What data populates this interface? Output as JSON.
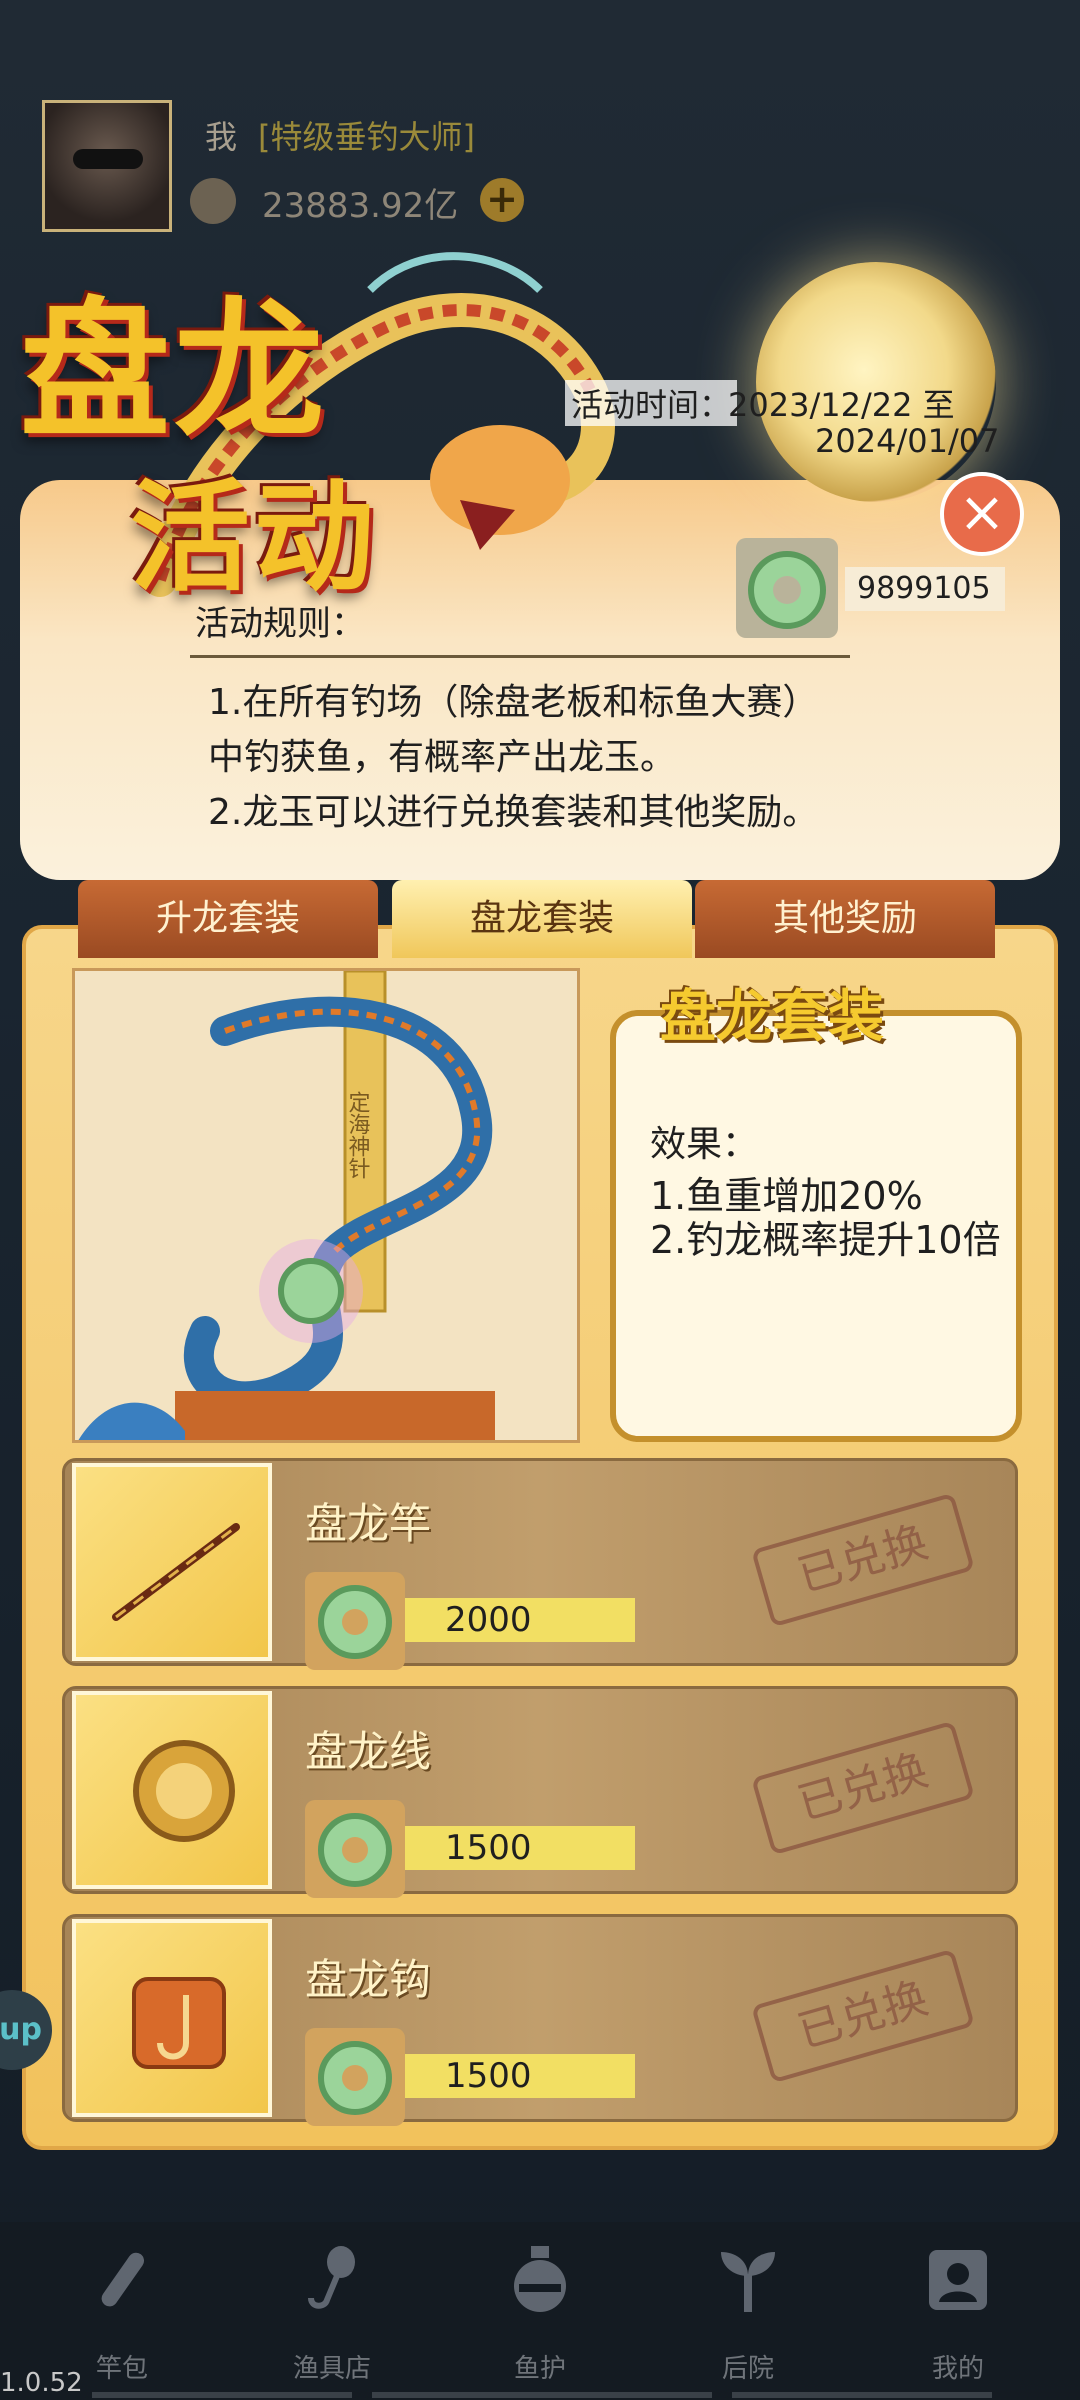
{
  "player": {
    "name": "我",
    "title": "[特级垂钓大师]",
    "coins": "23883.92亿",
    "add_icon": "+"
  },
  "event": {
    "title_line1": "盘龙",
    "title_line2": "活动",
    "time_label": "活动时间：",
    "time_start": "2023/12/22 至",
    "time_end": "2024/01/07",
    "close_icon": "close-icon",
    "jade_count": "9899105",
    "rules_title": "活动规则：",
    "rule_1a": "1.在所有钓场（除盘老板和标鱼大赛）",
    "rule_1b": "中钓获鱼，有概率产出龙玉。",
    "rule_2": "2.龙玉可以进行兑换套装和其他奖励。"
  },
  "tabs": [
    {
      "label": "升龙套装",
      "active": false
    },
    {
      "label": "盘龙套装",
      "active": true
    },
    {
      "label": "其他奖励",
      "active": false
    }
  ],
  "set": {
    "image_caption": "定海神针",
    "title": "盘龙套装",
    "effect_title": "效果：",
    "effect_1": "1.鱼重增加20%",
    "effect_2": "2.钓龙概率提升10倍"
  },
  "items": [
    {
      "name": "盘龙竿",
      "price": "2000",
      "status": "已兑换",
      "icon": "fishing-rod-icon"
    },
    {
      "name": "盘龙线",
      "price": "1500",
      "status": "已兑换",
      "icon": "fishing-line-icon"
    },
    {
      "name": "盘龙钩",
      "price": "1500",
      "status": "已兑换",
      "icon": "fishing-hook-icon"
    }
  ],
  "nav": [
    {
      "label": "竿包",
      "icon": "rod-bag-icon"
    },
    {
      "label": "渔具店",
      "icon": "tackle-shop-icon"
    },
    {
      "label": "鱼护",
      "icon": "fish-keeper-icon"
    },
    {
      "label": "后院",
      "icon": "backyard-icon"
    },
    {
      "label": "我的",
      "icon": "profile-icon"
    }
  ],
  "side_button": "up",
  "version": "1.0.52",
  "colors": {
    "gold": "#f4c22a",
    "panel": "#f2c25c",
    "redeemed": "#8a5440"
  }
}
